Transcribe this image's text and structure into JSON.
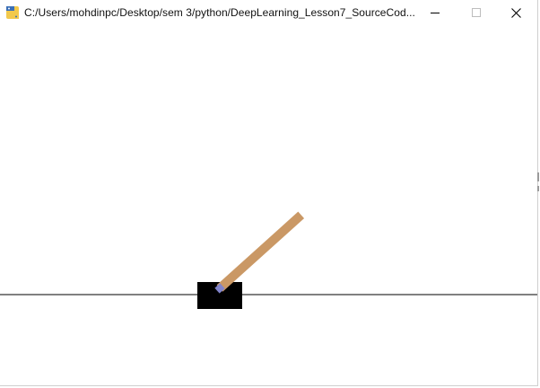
{
  "window": {
    "title": "C:/Users/mohdinpc/Desktop/sem 3/python/DeepLearning_Lesson7_SourceCod...",
    "icon": "python-icon",
    "controls": [
      "minimize-icon",
      "maximize-icon",
      "close-icon"
    ]
  },
  "scene": {
    "type": "cartpole-render",
    "pole_angle_deg": 48,
    "colors": {
      "background": "#ffffff",
      "track": "#000000",
      "cart": "#000000",
      "pole": "#ca9865",
      "axle": "#8184cb"
    }
  }
}
